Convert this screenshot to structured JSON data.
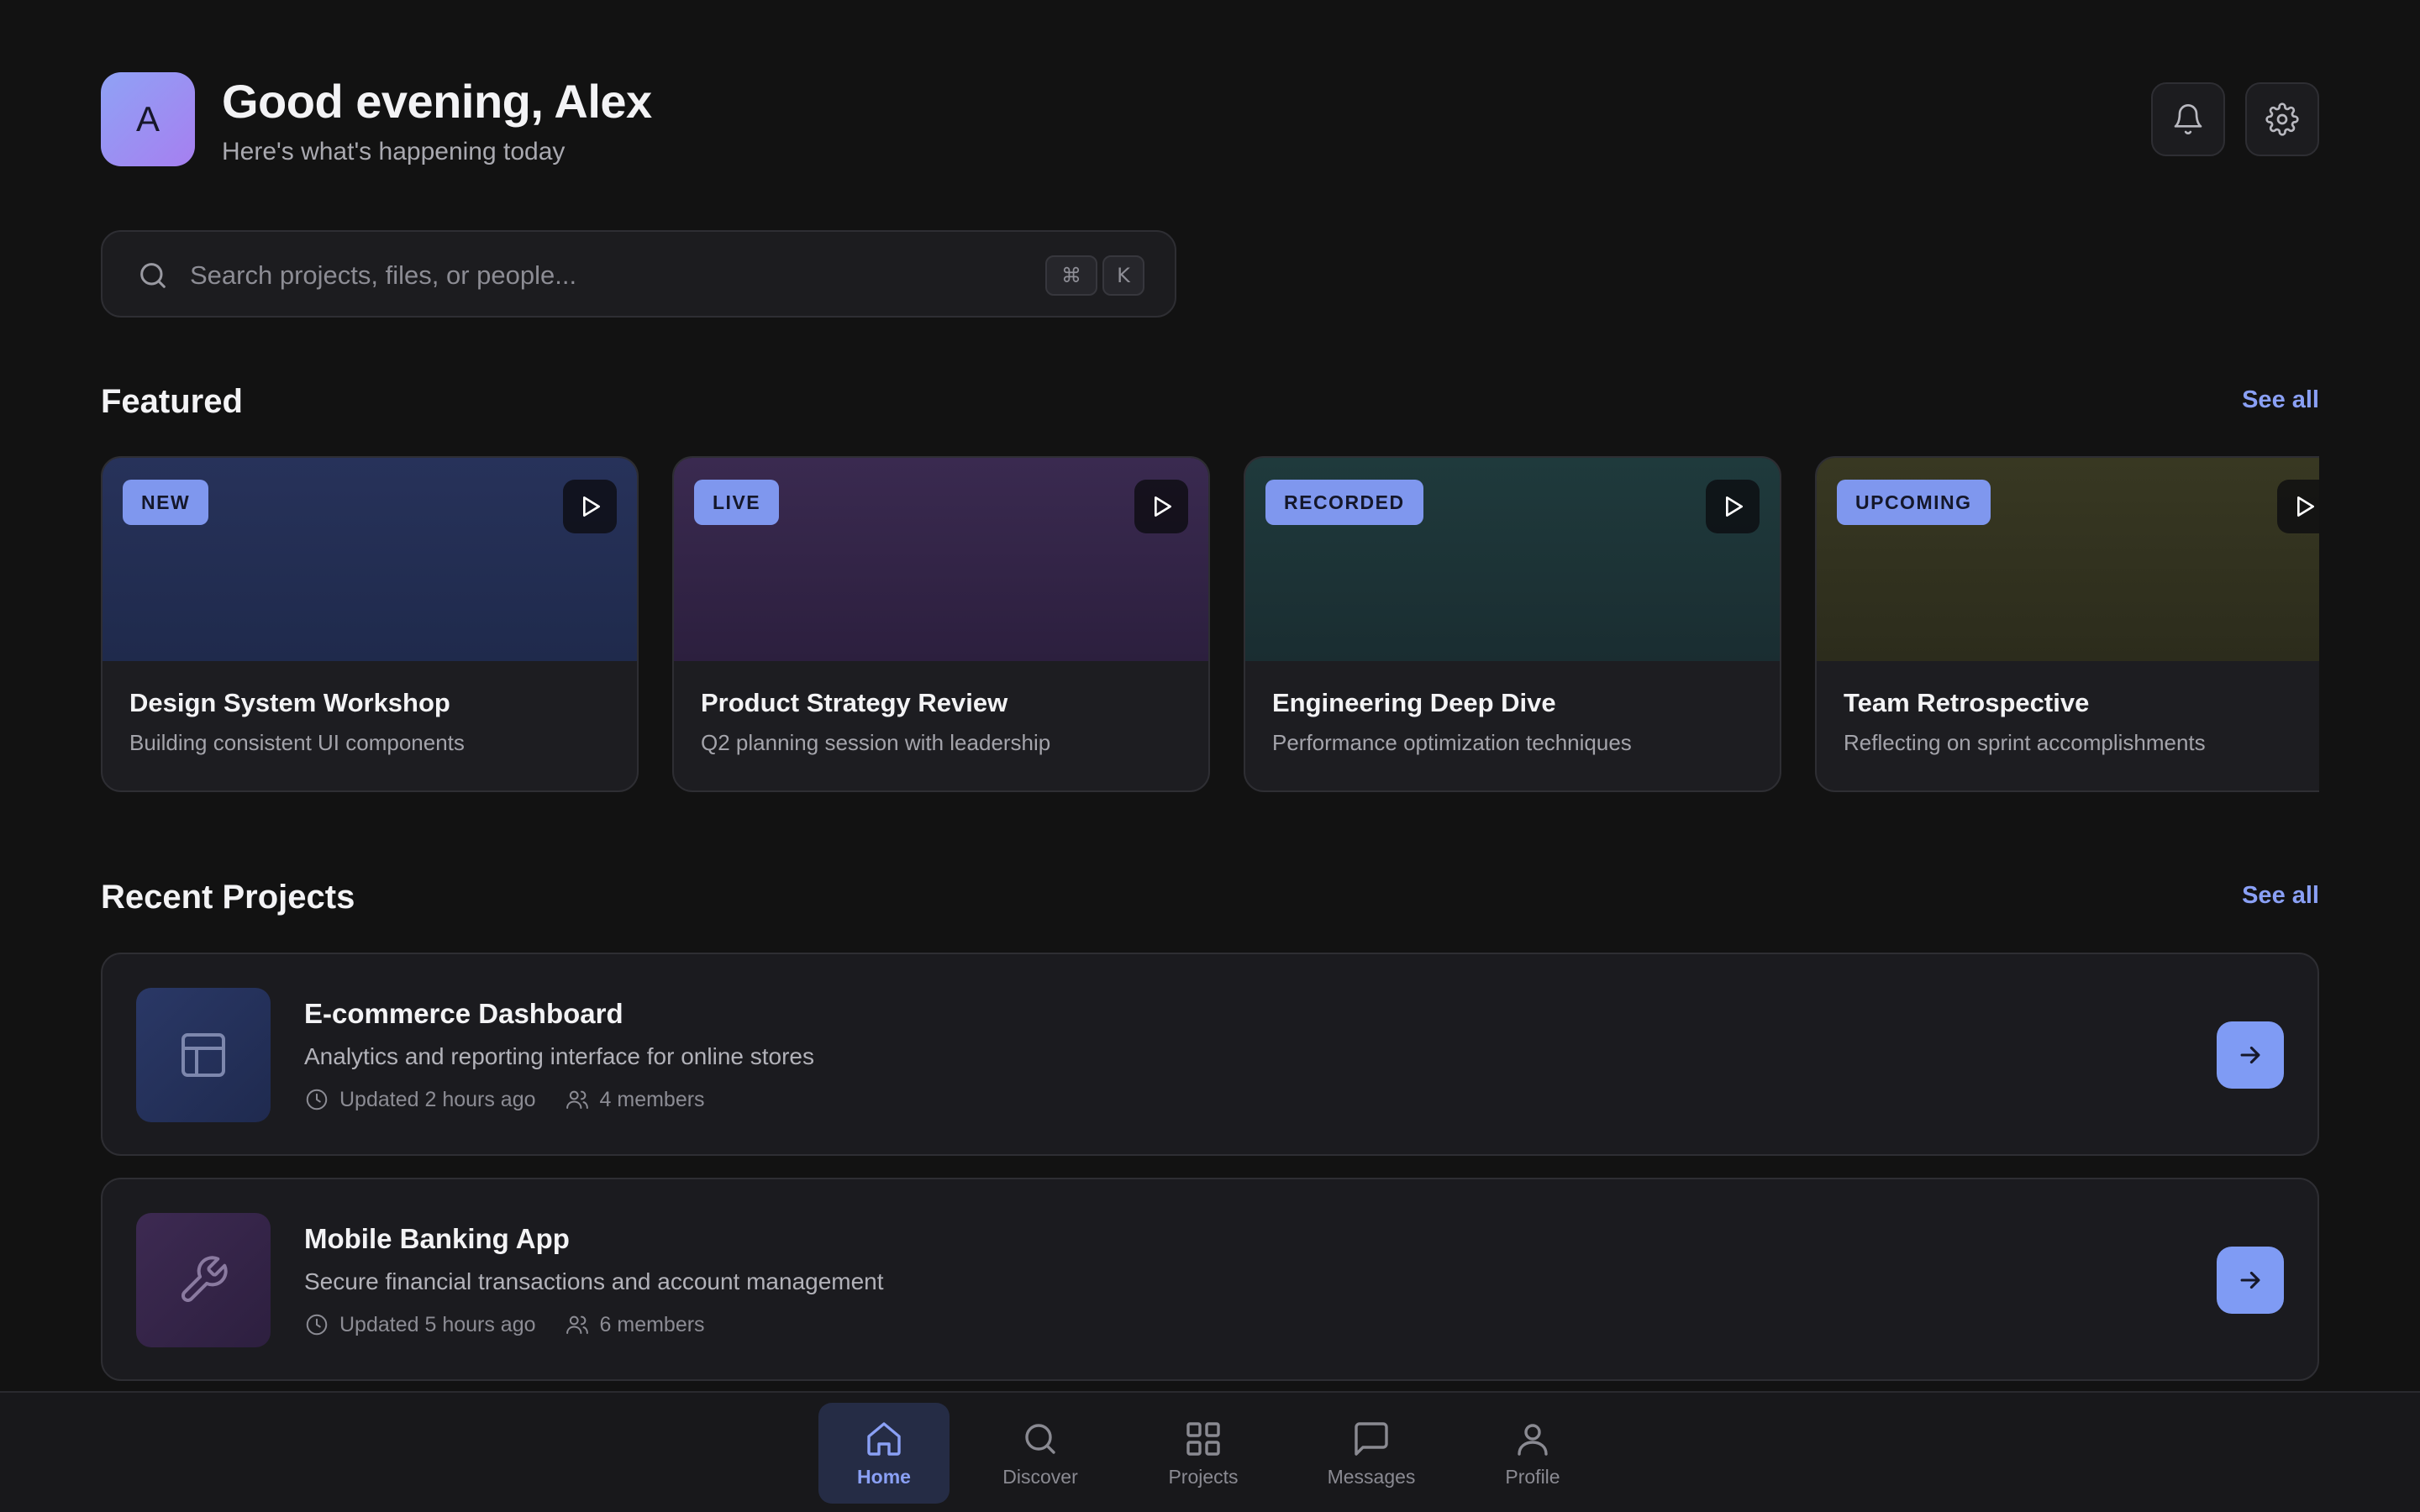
{
  "header": {
    "avatar_initial": "A",
    "greeting": "Good evening, Alex",
    "subtitle": "Here's what's happening today"
  },
  "search": {
    "placeholder": "Search projects, files, or people...",
    "value": "",
    "shortcut_keys": [
      "⌘",
      "K"
    ]
  },
  "featured": {
    "title": "Featured",
    "see_all": "See all",
    "cards": [
      {
        "badge": "NEW",
        "title": "Design System Workshop",
        "description": "Building consistent UI components",
        "color": "#27325a"
      },
      {
        "badge": "LIVE",
        "title": "Product Strategy Review",
        "description": "Q2 planning session with leadership",
        "color": "#35264a"
      },
      {
        "badge": "RECORDED",
        "title": "Engineering Deep Dive",
        "description": "Performance optimization techniques",
        "color": "#1f3438"
      },
      {
        "badge": "UPCOMING",
        "title": "Team Retrospective",
        "description": "Reflecting on sprint accomplishments",
        "color": "#33331f"
      }
    ]
  },
  "projects": {
    "title": "Recent Projects",
    "see_all": "See all",
    "items": [
      {
        "title": "E-commerce Dashboard",
        "description": "Analytics and reporting interface for online stores",
        "updated": "Updated 2 hours ago",
        "members": "4 members",
        "icon": "layout-icon",
        "color": "#27325a"
      },
      {
        "title": "Mobile Banking App",
        "description": "Secure financial transactions and account management",
        "updated": "Updated 5 hours ago",
        "members": "6 members",
        "icon": "wrench-icon",
        "color": "#35264a"
      }
    ]
  },
  "nav": {
    "items": [
      {
        "label": "Home",
        "icon": "home-icon",
        "active": true
      },
      {
        "label": "Discover",
        "icon": "search-icon",
        "active": false
      },
      {
        "label": "Projects",
        "icon": "grid-icon",
        "active": false
      },
      {
        "label": "Messages",
        "icon": "message-icon",
        "active": false
      },
      {
        "label": "Profile",
        "icon": "user-icon",
        "active": false
      }
    ]
  },
  "colors": {
    "accent": "#8aa0f5",
    "background": "#121212",
    "card": "#1d1d21"
  }
}
